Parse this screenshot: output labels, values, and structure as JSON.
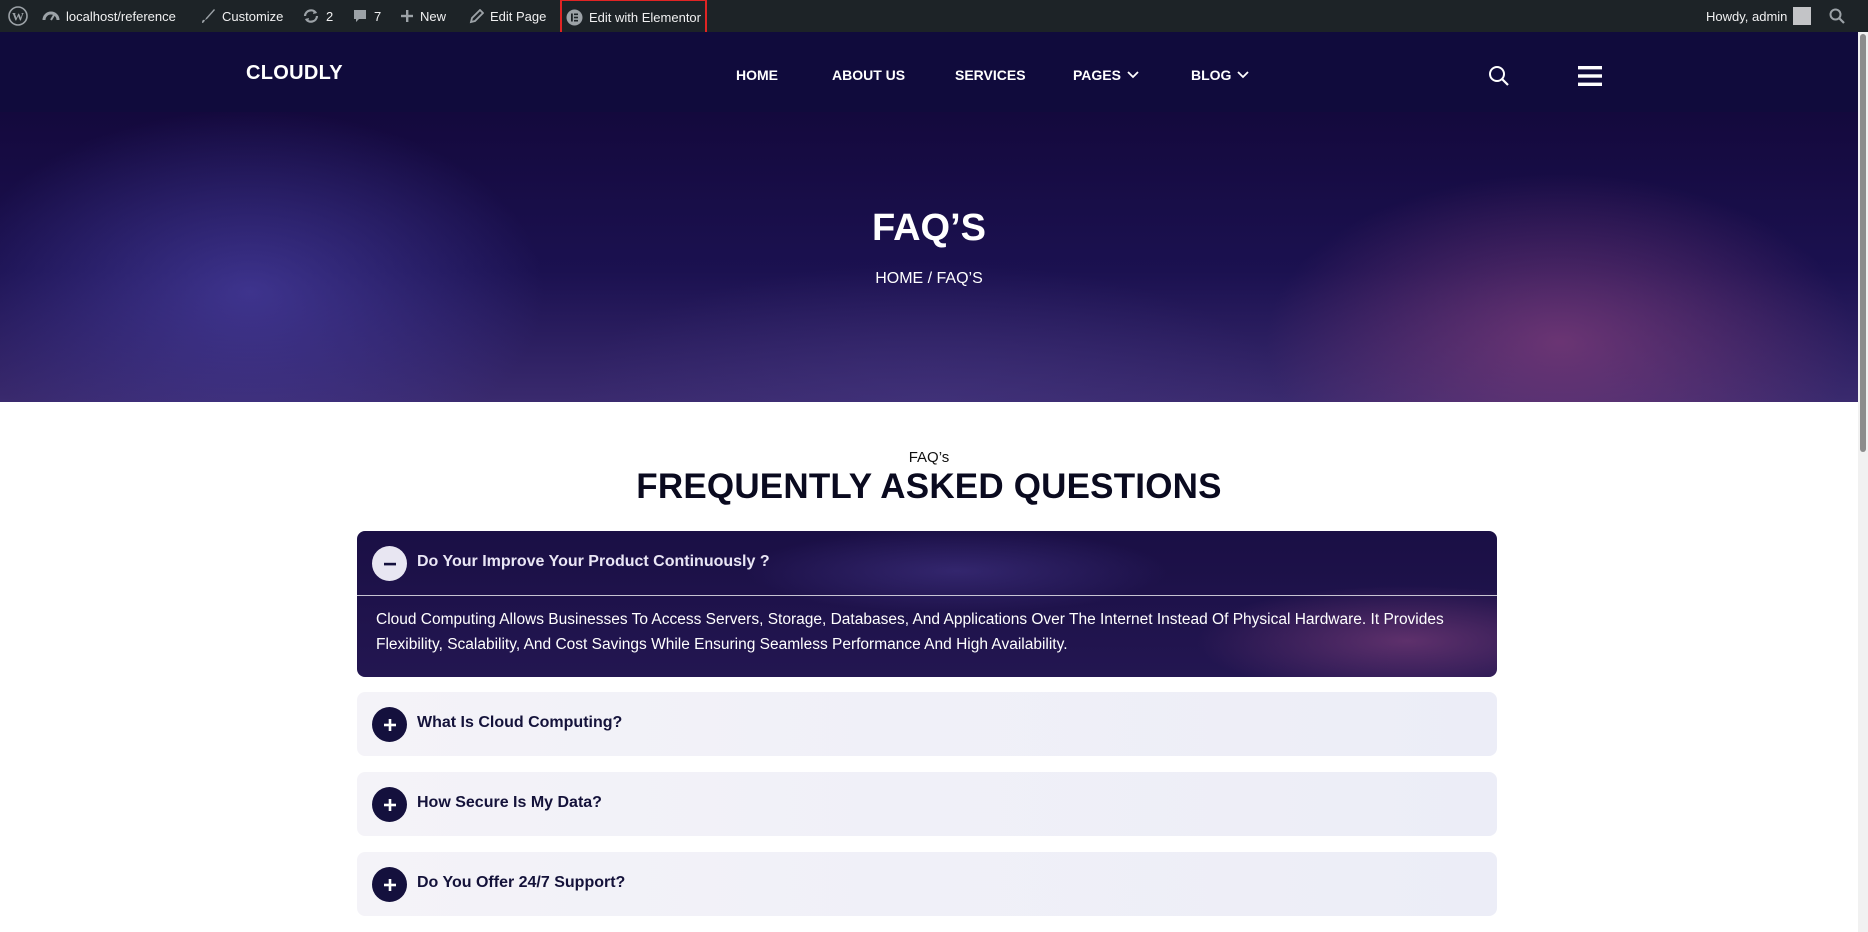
{
  "admin_bar": {
    "site": "localhost/reference",
    "customize": "Customize",
    "updates_count": "2",
    "comments_count": "7",
    "new": "New",
    "edit_page": "Edit Page",
    "edit_elementor": "Edit with Elementor",
    "greeting": "Howdy, admin"
  },
  "header": {
    "logo": "CLOUDLY",
    "nav": [
      "HOME",
      "ABOUT US",
      "SERVICES",
      "PAGES",
      "BLOG"
    ]
  },
  "hero": {
    "title": "FAQ’S",
    "breadcrumb": "HOME / FAQ’S"
  },
  "faq": {
    "subtitle": "FAQ’s",
    "title": "FREQUENTLY ASKED QUESTIONS",
    "items": [
      {
        "question": "Do Your Improve Your Product Continuously ?",
        "answer": "Cloud Computing Allows Businesses To Access Servers, Storage, Databases, And Applications Over The Internet Instead Of Physical Hardware. It Provides Flexibility, Scalability, And Cost Savings While Ensuring Seamless Performance And High Availability.",
        "expanded": true
      },
      {
        "question": "What Is Cloud Computing?",
        "expanded": false
      },
      {
        "question": "How Secure Is My Data?",
        "expanded": false
      },
      {
        "question": "Do You Offer 24/7 Support?",
        "expanded": false
      }
    ]
  },
  "colors": {
    "admin_bar": "#1d2327",
    "header_bg": "#100b3c",
    "accent_dark": "#14103d",
    "highlight_outline": "#e02424"
  }
}
